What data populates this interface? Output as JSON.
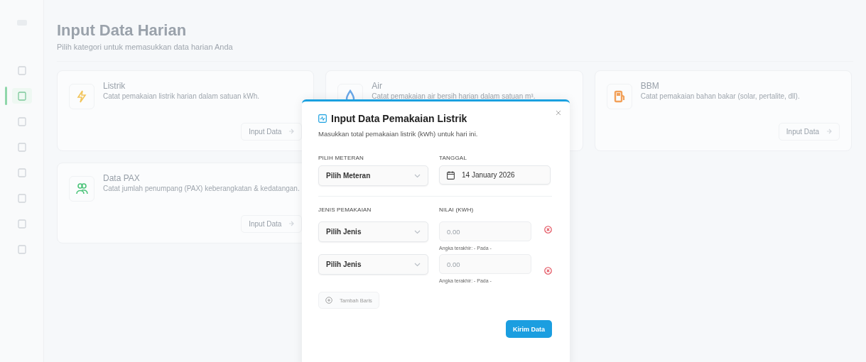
{
  "sidebar": {
    "items": [
      {
        "selected": false
      },
      {
        "selected": true
      },
      {
        "selected": false
      },
      {
        "selected": false
      },
      {
        "selected": false
      },
      {
        "selected": false
      },
      {
        "selected": false
      },
      {
        "selected": false
      }
    ]
  },
  "header": {
    "title": "Input Data Harian",
    "subtitle": "Pilih kategori untuk memasukkan data harian Anda"
  },
  "categories": [
    {
      "kind": "electric",
      "color": "#f2c45a",
      "name": "Listrik",
      "description": "Catat pemakaian listrik harian dalam satuan kWh.",
      "button": "Input Data"
    },
    {
      "kind": "water",
      "color": "#6aa8e8",
      "name": "Air",
      "description": "Catat pemakaian air bersih harian dalam satuan m³."
    },
    {
      "kind": "fuel",
      "color": "#f2a15a",
      "name": "BBM",
      "description": "Catat pemakaian bahan bakar (solar, pertalite, dll).",
      "button": "Input Data"
    },
    {
      "kind": "people",
      "color": "#4cc47a",
      "name": "Data PAX",
      "description": "Catat jumlah penumpang (PAX) keberangkatan & kedatangan.",
      "button": "Input Data"
    }
  ],
  "modal": {
    "title": "Input Data Pemakaian Listrik",
    "description": "Masukkan total pemakaian listrik (kWh) untuk hari ini.",
    "meter": {
      "label": "PILIH METERAN",
      "value": "Pilih Meteran"
    },
    "date": {
      "label": "TANGGAL",
      "value": "14 January 2026"
    },
    "usage_label": "JENIS PEMAKAIAN",
    "value_label": "NILAI (KWH)",
    "rows": [
      {
        "type": "Pilih Jenis",
        "placeholder": "0.00",
        "hint": "Angka terakhir: - Pada -"
      },
      {
        "type": "Pilih Jenis",
        "placeholder": "0.00",
        "hint": "Angka terakhir: - Pada -"
      }
    ],
    "add_button": "Tambah Baris",
    "submit_button": "Kirim Data"
  }
}
